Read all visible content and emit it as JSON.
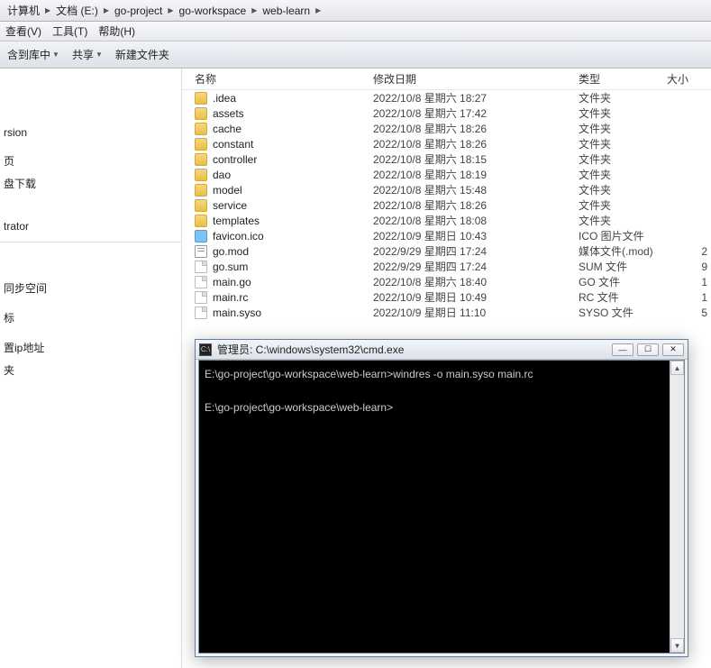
{
  "breadcrumb": [
    "计算机",
    "文档 (E:)",
    "go-project",
    "go-workspace",
    "web-learn"
  ],
  "menu": {
    "view": "查看(V)",
    "tools": "工具(T)",
    "help": "帮助(H)"
  },
  "toolbar": {
    "include": "含到库中",
    "share": "共享",
    "newfolder": "新建文件夹"
  },
  "sidebar": {
    "items": [
      "rsion",
      "页",
      "盘下载",
      "",
      "trator",
      "",
      "",
      "同步空间",
      "",
      "标",
      "",
      "置ip地址",
      "夹"
    ]
  },
  "columns": {
    "name": "名称",
    "modified": "修改日期",
    "type": "类型",
    "size": "大小"
  },
  "files": [
    {
      "name": ".idea",
      "date": "2022/10/8 星期六 18:27",
      "type": "文件夹",
      "kind": "folder",
      "size": ""
    },
    {
      "name": "assets",
      "date": "2022/10/8 星期六 17:42",
      "type": "文件夹",
      "kind": "folder",
      "size": ""
    },
    {
      "name": "cache",
      "date": "2022/10/8 星期六 18:26",
      "type": "文件夹",
      "kind": "folder",
      "size": ""
    },
    {
      "name": "constant",
      "date": "2022/10/8 星期六 18:26",
      "type": "文件夹",
      "kind": "folder",
      "size": ""
    },
    {
      "name": "controller",
      "date": "2022/10/8 星期六 18:15",
      "type": "文件夹",
      "kind": "folder",
      "size": ""
    },
    {
      "name": "dao",
      "date": "2022/10/8 星期六 18:19",
      "type": "文件夹",
      "kind": "folder",
      "size": ""
    },
    {
      "name": "model",
      "date": "2022/10/8 星期六 15:48",
      "type": "文件夹",
      "kind": "folder",
      "size": ""
    },
    {
      "name": "service",
      "date": "2022/10/8 星期六 18:26",
      "type": "文件夹",
      "kind": "folder",
      "size": ""
    },
    {
      "name": "templates",
      "date": "2022/10/8 星期六 18:08",
      "type": "文件夹",
      "kind": "folder",
      "size": ""
    },
    {
      "name": "favicon.ico",
      "date": "2022/10/9 星期日 10:43",
      "type": "ICO 图片文件",
      "kind": "ico",
      "size": ""
    },
    {
      "name": "go.mod",
      "date": "2022/9/29 星期四 17:24",
      "type": "媒体文件(.mod)",
      "kind": "mod",
      "size": "2"
    },
    {
      "name": "go.sum",
      "date": "2022/9/29 星期四 17:24",
      "type": "SUM 文件",
      "kind": "file",
      "size": "9"
    },
    {
      "name": "main.go",
      "date": "2022/10/8 星期六 18:40",
      "type": "GO 文件",
      "kind": "file",
      "size": "1"
    },
    {
      "name": "main.rc",
      "date": "2022/10/9 星期日 10:49",
      "type": "RC 文件",
      "kind": "file",
      "size": "1"
    },
    {
      "name": "main.syso",
      "date": "2022/10/9 星期日 11:10",
      "type": "SYSO 文件",
      "kind": "file",
      "size": "5"
    }
  ],
  "cmd": {
    "title": "管理员: C:\\windows\\system32\\cmd.exe",
    "line1": "E:\\go-project\\go-workspace\\web-learn>windres -o main.syso main.rc",
    "line2": "E:\\go-project\\go-workspace\\web-learn>"
  }
}
